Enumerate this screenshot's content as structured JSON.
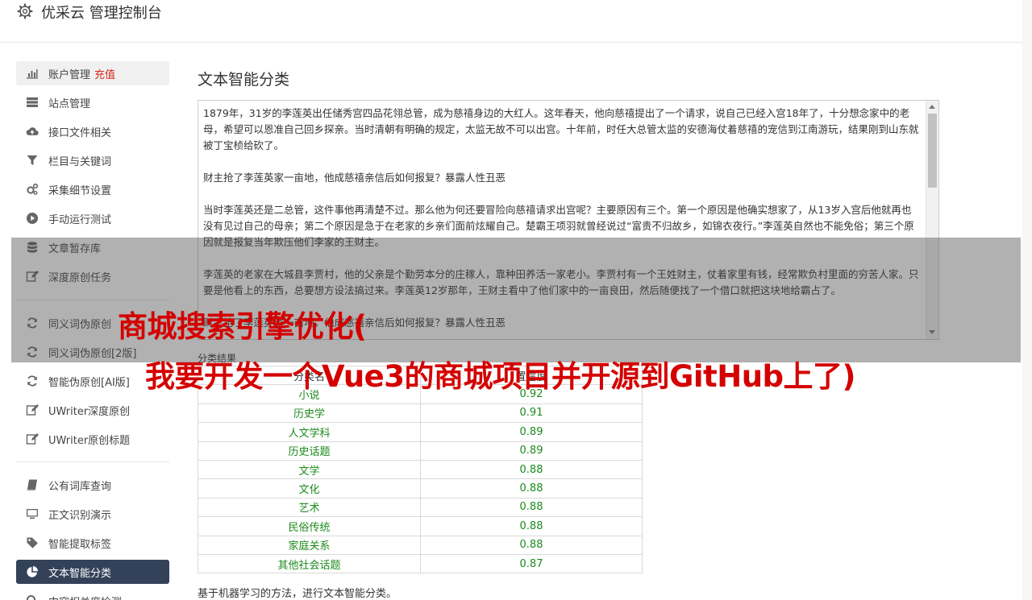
{
  "header": {
    "title": "优采云 管理控制台",
    "icon": "gear-icon"
  },
  "sidebar": {
    "items": [
      {
        "label": "账户管理",
        "extra": "充值",
        "icon": "bar-chart-icon"
      },
      {
        "label": "站点管理",
        "icon": "server-icon"
      },
      {
        "label": "接口文件相关",
        "icon": "cloud-upload-icon"
      },
      {
        "label": "栏目与关键词",
        "icon": "filter-icon"
      },
      {
        "label": "采集细节设置",
        "icon": "cogs-icon"
      },
      {
        "label": "手动运行测试",
        "icon": "play-circle-icon"
      },
      {
        "label": "文章暂存库",
        "icon": "database-icon"
      },
      {
        "label": "深度原创任务",
        "icon": "edit-icon"
      },
      {
        "label": "同义词伪原创",
        "icon": "refresh-icon"
      },
      {
        "label": "同义词伪原创[2版]",
        "icon": "refresh-icon"
      },
      {
        "label": "智能伪原创[AI版]",
        "icon": "refresh-icon"
      },
      {
        "label": "UWriter深度原创",
        "icon": "edit-icon"
      },
      {
        "label": "UWriter原创标题",
        "icon": "edit-icon"
      },
      {
        "label": "公有词库查询",
        "icon": "book-icon"
      },
      {
        "label": "正文识别演示",
        "icon": "monitor-icon"
      },
      {
        "label": "智能提取标签",
        "icon": "tag-icon"
      },
      {
        "label": "文本智能分类",
        "icon": "pie-chart-icon"
      },
      {
        "label": "内容相关度检测",
        "icon": "search-icon"
      }
    ]
  },
  "main": {
    "title": "文本智能分类",
    "text": "1879年，31岁的李莲英出任储秀宫四品花翎总管，成为慈禧身边的大红人。这年春天，他向慈禧提出了一个请求，说自己已经入宫18年了，十分想念家中的老母，希望可以恩准自己回乡探亲。当时清朝有明确的规定，太监无故不可以出宫。十年前，时任大总管太监的安德海仗着慈禧的宠信到江南游玩，结果刚到山东就被丁宝桢给砍了。\n\n财主抢了李莲英家一亩地，他成慈禧亲信后如何报复？暴露人性丑恶\n\n当时李莲英还是二总管，这件事他再清楚不过。那么他为何还要冒险向慈禧请求出宫呢？主要原因有三个。第一个原因是他确实想家了，从13岁入宫后他就再也没有见过自己的母亲；第二个原因是急于在老家的乡亲们面前炫耀自己。楚霸王项羽就曾经说过“富贵不归故乡，如锦衣夜行。”李莲英自然也不能免俗；第三个原因就是报复当年欺压他们李家的王财主。\n\n李莲英的老家在大城县李贾村，他的父亲是个勤劳本分的庄稼人，靠种田养活一家老小。李贾村有一个王姓财主，仗着家里有钱，经常欺负村里面的穷苦人家。只要是他看上的东西，总要想方设法搞过来。李莲英12岁那年，王财主看中了他们家中的一亩良田，然后随便找了一个借口就把这块地给霸占了。\n\n财主抢了李莲英家一亩地，他成慈禧亲信后如何报复？暴露人性丑恶",
    "result_label": "分类结果",
    "table": {
      "headers": [
        "分类名",
        "置信度"
      ],
      "rows": [
        [
          "小说",
          "0.92"
        ],
        [
          "历史学",
          "0.91"
        ],
        [
          "人文学科",
          "0.89"
        ],
        [
          "历史话题",
          "0.89"
        ],
        [
          "文学",
          "0.88"
        ],
        [
          "文化",
          "0.88"
        ],
        [
          "艺术",
          "0.88"
        ],
        [
          "民俗传统",
          "0.88"
        ],
        [
          "家庭关系",
          "0.88"
        ],
        [
          "其他社会话题",
          "0.87"
        ]
      ]
    },
    "footnote": "基于机器学习的方法，进行文本智能分类。"
  },
  "overlay": {
    "line1": "商城搜索引擎优化(",
    "line2": "我要开发一个Vue3的商城项目并开源到GitHub上了)"
  },
  "colors": {
    "active_nav": "#334259",
    "red_link": "#d9261c",
    "table_value": "#1c8a1c",
    "overlay_text": "#d40000"
  }
}
